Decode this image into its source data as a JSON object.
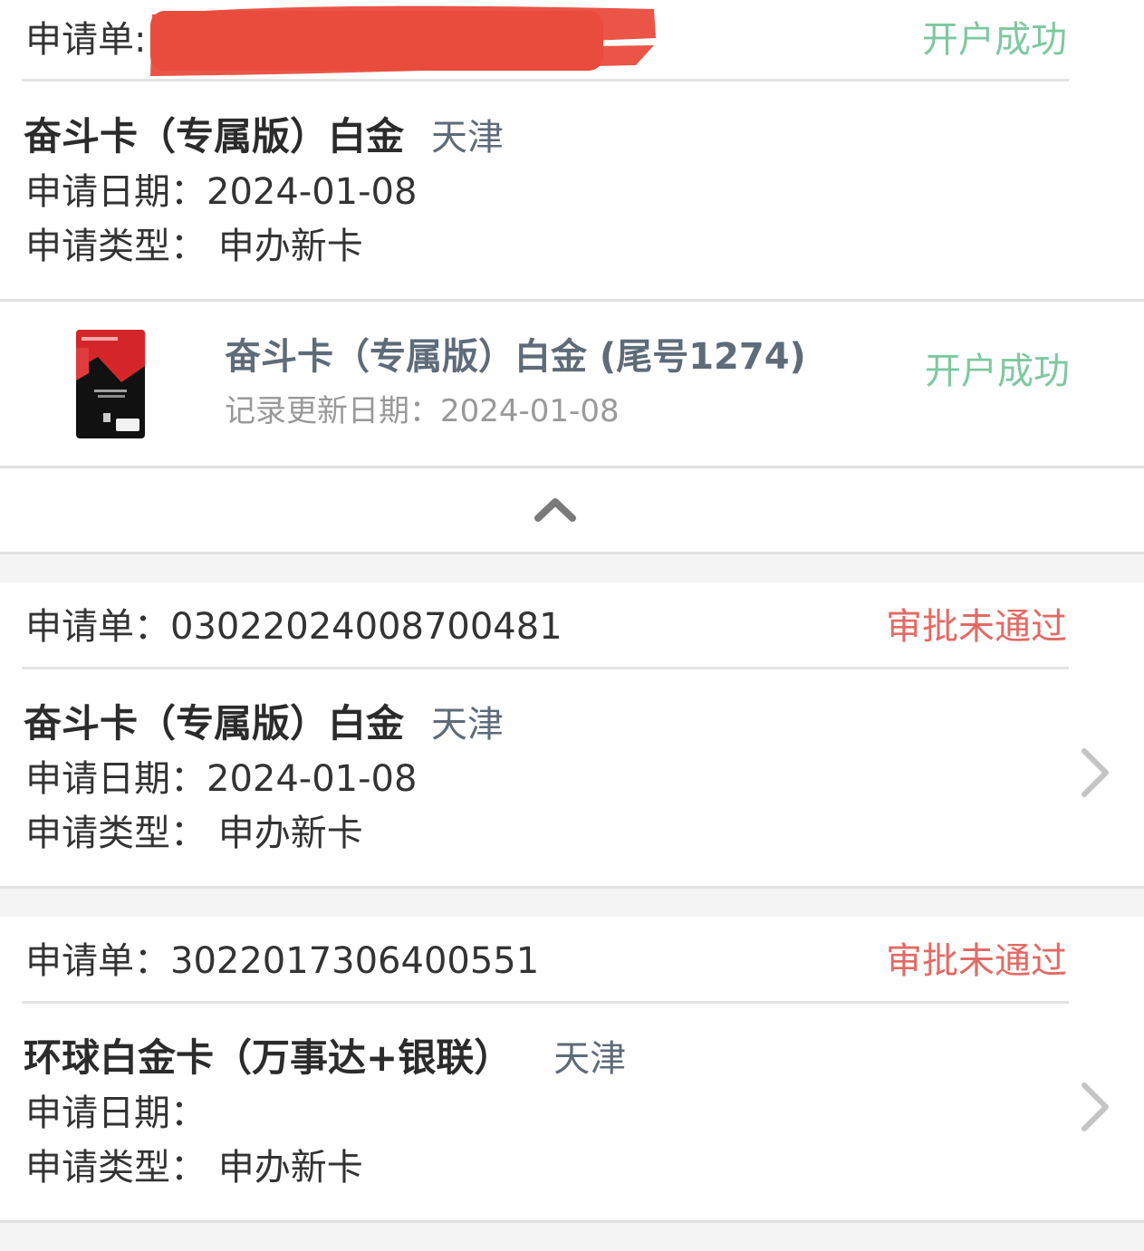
{
  "colors": {
    "success": "#7ec8a0",
    "rejected": "#e36a64",
    "city": "#5e6b79",
    "redaction": "#e94c3d"
  },
  "card1": {
    "order_label": "申请单:",
    "status": "开户成功",
    "product": "奋斗卡（专属版）白金",
    "city": "天津",
    "date_line": "申请日期：2024-01-08",
    "type_line": "申请类型： 申办新卡",
    "detail": {
      "title": "奋斗卡（专属版）白金 (尾号1274)",
      "updated": "记录更新日期：2024-01-08",
      "status": "开户成功"
    }
  },
  "card2": {
    "order_label": "申请单：03022024008700481",
    "status": "审批未通过",
    "product": "奋斗卡（专属版）白金",
    "city": "天津",
    "date_line": "申请日期：2024-01-08",
    "type_line": "申请类型： 申办新卡"
  },
  "card3": {
    "order_label": "申请单：3022017306400551",
    "status": "审批未通过",
    "product": "环球白金卡（万事达+银联）",
    "city": "天津",
    "date_line": "申请日期：",
    "type_line": "申请类型： 申办新卡"
  },
  "icons": {
    "collapse": "chevron-up-icon",
    "open": "chevron-right-icon",
    "card": "credit-card-thumbnail"
  }
}
